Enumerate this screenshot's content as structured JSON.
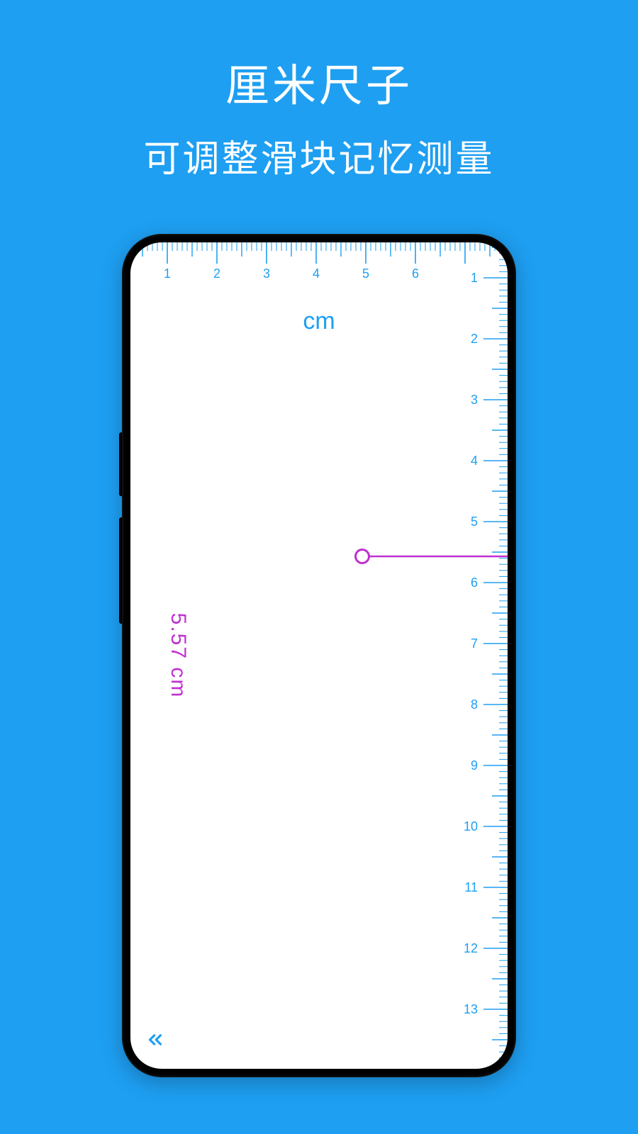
{
  "title": "厘米尺子",
  "subtitle": "可调整滑块记忆测量",
  "unit_label": "cm",
  "measurement": "5.57 cm",
  "back_icon": "chevron-double-left",
  "colors": {
    "bg": "#1E9FF2",
    "accent": "#1E9FF2",
    "slider": "#C030D0"
  },
  "top_ruler": {
    "major": [
      1,
      2,
      3,
      4,
      5,
      6
    ],
    "minor_per_major": 10
  },
  "right_ruler": {
    "major": [
      1,
      2,
      3,
      4,
      5,
      6,
      7,
      8,
      9,
      10,
      11,
      12,
      13
    ],
    "minor_per_major": 10
  },
  "slider_value_cm": 5.57
}
